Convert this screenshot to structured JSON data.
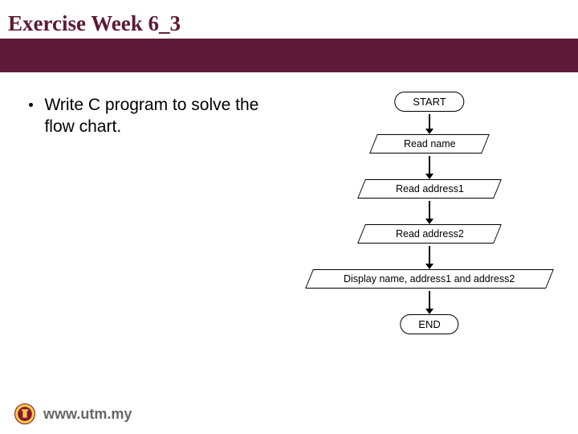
{
  "title": "Exercise Week 6_3",
  "bullet": "Write C program to solve the flow chart.",
  "flowchart": {
    "start": "START",
    "step1": "Read name",
    "step2": "Read address1",
    "step3": "Read address2",
    "step4": "Display name, address1 and address2",
    "end": "END"
  },
  "footer": {
    "url": "www.utm.my"
  }
}
